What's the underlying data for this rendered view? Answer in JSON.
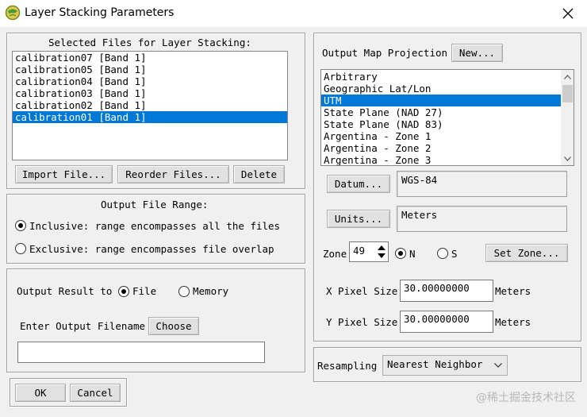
{
  "window": {
    "title": "Layer Stacking Parameters",
    "app_icon": "envi-globe-icon",
    "close_icon": "close-icon"
  },
  "selected_files": {
    "heading": "Selected Files for Layer Stacking:",
    "items": [
      "calibration07 [Band 1]",
      "calibration05 [Band 1]",
      "calibration04 [Band 1]",
      "calibration03 [Band 1]",
      "calibration02 [Band 1]",
      "calibration01 [Band 1]"
    ],
    "selected_index": 5,
    "import_label": "Import File...",
    "reorder_label": "Reorder Files...",
    "delete_label": "Delete"
  },
  "range": {
    "heading": "Output File Range:",
    "inclusive_label": "Inclusive: range encompasses all the files",
    "exclusive_label": "Exclusive: range encompasses file overlap"
  },
  "output": {
    "result_to_label": "Output Result to",
    "file_label": "File",
    "memory_label": "Memory",
    "filename_label": "Enter Output Filename",
    "choose_label": "Choose",
    "filename_value": ""
  },
  "footer": {
    "ok_label": "OK",
    "cancel_label": "Cancel"
  },
  "projection": {
    "heading": "Output Map Projection",
    "new_label": "New...",
    "items": [
      "Arbitrary",
      "Geographic Lat/Lon",
      "UTM",
      "State Plane (NAD 27)",
      "State Plane (NAD 83)",
      "Argentina - Zone 1",
      "Argentina - Zone 2",
      "Argentina - Zone 3"
    ],
    "selected_index": 2,
    "datum_label": "Datum...",
    "datum_value": "WGS-84",
    "units_label": "Units...",
    "units_value": "Meters",
    "zone_label": "Zone",
    "zone_value": "49",
    "n_label": "N",
    "s_label": "S",
    "set_zone_label": "Set Zone...",
    "x_pixel_label": "X Pixel Size",
    "x_pixel_value": "30.00000000",
    "x_pixel_unit": "Meters",
    "y_pixel_label": "Y Pixel Size",
    "y_pixel_value": "30.00000000",
    "y_pixel_unit": "Meters"
  },
  "resampling": {
    "label": "Resampling",
    "value": "Nearest Neighbor"
  },
  "watermark": "@稀土掘金技术社区",
  "colors": {
    "selection": "#0078d7",
    "window_bg": "#f0f0f0"
  }
}
